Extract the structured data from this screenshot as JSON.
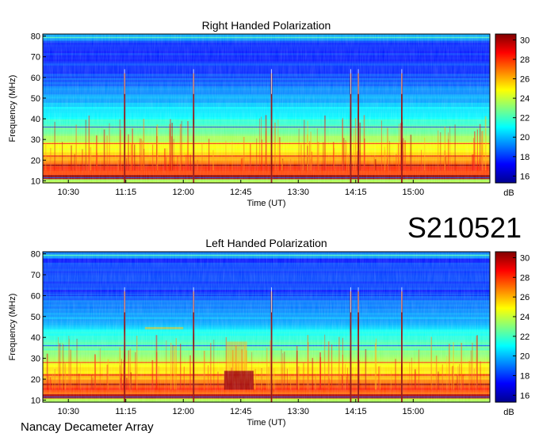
{
  "event_label": "S210521",
  "instrument": "Nancay Decameter Array",
  "chart_data": [
    {
      "type": "heatmap",
      "title": "Right Handed Polarization",
      "xlabel": "Time (UT)",
      "ylabel": "Frequency (MHz)",
      "xlim": [
        "10:10",
        "16:00"
      ],
      "ylim": [
        9,
        81
      ],
      "xticks": [
        "10:30",
        "11:15",
        "12:00",
        "12:45",
        "13:30",
        "14:15",
        "15:00"
      ],
      "yticks": [
        "10",
        "20",
        "30",
        "40",
        "50",
        "60",
        "70",
        "80"
      ],
      "colorbar": {
        "label": "dB",
        "range": [
          15.3,
          30.6
        ],
        "ticks": [
          "16",
          "18",
          "20",
          "22",
          "24",
          "26",
          "28",
          "30"
        ],
        "colormap": "jet"
      },
      "bursts_ut": [
        "11:14",
        "12:08",
        "13:09",
        "14:11",
        "14:17",
        "14:51"
      ]
    },
    {
      "type": "heatmap",
      "title": "Left Handed Polarization",
      "xlabel": "Time (UT)",
      "ylabel": "Frequency (MHz)",
      "xlim": [
        "10:10",
        "16:00"
      ],
      "ylim": [
        9,
        81
      ],
      "xticks": [
        "10:30",
        "11:15",
        "12:00",
        "12:45",
        "13:30",
        "14:15",
        "15:00"
      ],
      "yticks": [
        "10",
        "20",
        "30",
        "40",
        "50",
        "60",
        "70",
        "80"
      ],
      "colorbar": {
        "label": "dB",
        "range": [
          15.3,
          30.6
        ],
        "ticks": [
          "16",
          "18",
          "20",
          "22",
          "24",
          "26",
          "28",
          "30"
        ],
        "colormap": "jet"
      },
      "bursts_ut": [
        "11:14",
        "12:08",
        "13:09",
        "14:11",
        "14:17",
        "14:51"
      ]
    }
  ]
}
